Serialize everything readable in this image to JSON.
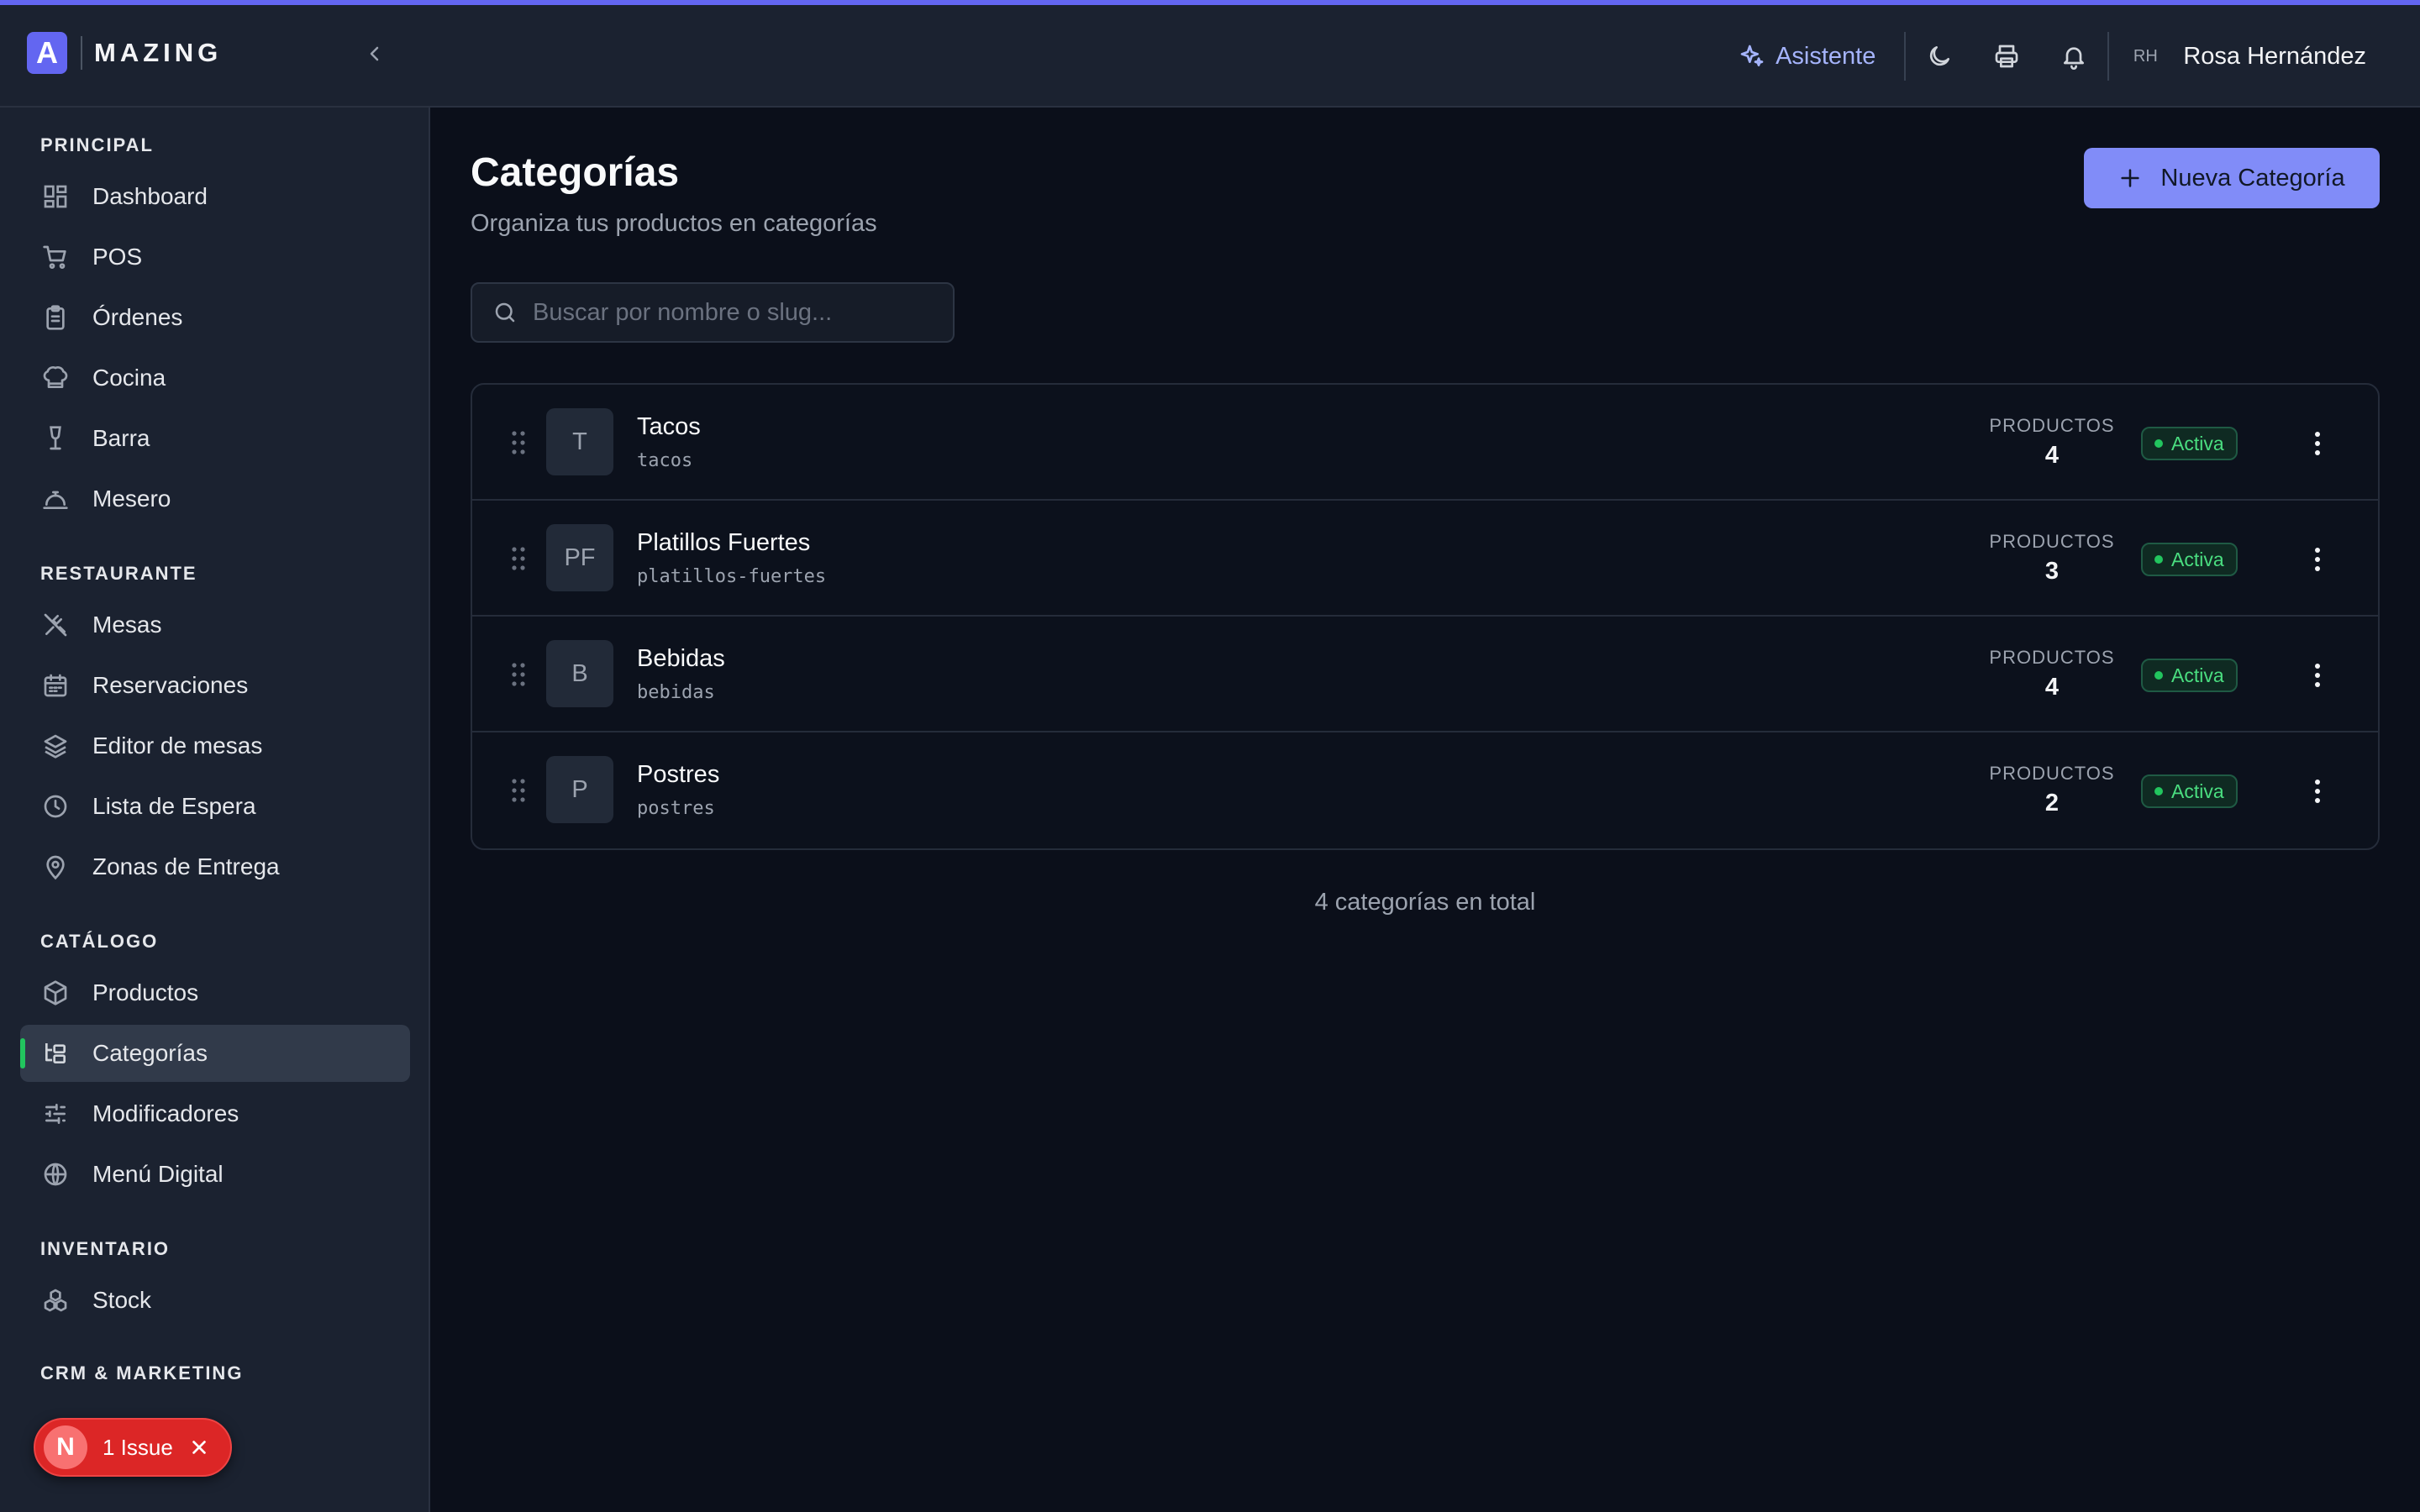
{
  "header": {
    "logo_letter": "A",
    "logo_text": "MAZING",
    "assistant_label": "Asistente",
    "user_initials": "RH",
    "user_name": "Rosa Hernández",
    "icons": [
      "sparkle-icon",
      "moon-icon",
      "printer-icon",
      "bell-icon",
      "chevron-left-icon"
    ]
  },
  "sidebar": {
    "sections": {
      "principal": "PRINCIPAL",
      "restaurante": "RESTAURANTE",
      "catalogo": "CATÁLOGO",
      "inventario": "INVENTARIO",
      "crm": "CRM & MARKETING"
    },
    "items": [
      {
        "label": "Dashboard",
        "icon": "dashboard-icon"
      },
      {
        "label": "POS",
        "icon": "cart-icon"
      },
      {
        "label": "Órdenes",
        "icon": "clipboard-icon"
      },
      {
        "label": "Cocina",
        "icon": "chef-hat-icon"
      },
      {
        "label": "Barra",
        "icon": "wine-glass-icon"
      },
      {
        "label": "Mesero",
        "icon": "service-bell-icon"
      },
      {
        "label": "Mesas",
        "icon": "utensils-icon"
      },
      {
        "label": "Reservaciones",
        "icon": "calendar-icon"
      },
      {
        "label": "Editor de mesas",
        "icon": "layers-icon"
      },
      {
        "label": "Lista de Espera",
        "icon": "clock-icon"
      },
      {
        "label": "Zonas de Entrega",
        "icon": "map-pin-icon"
      },
      {
        "label": "Productos",
        "icon": "package-icon"
      },
      {
        "label": "Categorías",
        "icon": "folder-tree-icon",
        "active": true
      },
      {
        "label": "Modificadores",
        "icon": "sliders-icon"
      },
      {
        "label": "Menú Digital",
        "icon": "globe-icon"
      },
      {
        "label": "Stock",
        "icon": "boxes-icon"
      }
    ]
  },
  "issue": {
    "letter": "N",
    "label": "1 Issue"
  },
  "main": {
    "title": "Categorías",
    "subtitle": "Organiza tus productos en categorías",
    "new_button": "Nueva Categoría",
    "search_placeholder": "Buscar por nombre o slug...",
    "products_label": "PRODUCTOS",
    "rows": [
      {
        "initials": "T",
        "name": "Tacos",
        "slug": "tacos",
        "count": "4",
        "status": "Activa"
      },
      {
        "initials": "PF",
        "name": "Platillos Fuertes",
        "slug": "platillos-fuertes",
        "count": "3",
        "status": "Activa"
      },
      {
        "initials": "B",
        "name": "Bebidas",
        "slug": "bebidas",
        "count": "4",
        "status": "Activa"
      },
      {
        "initials": "P",
        "name": "Postres",
        "slug": "postres",
        "count": "2",
        "status": "Activa"
      }
    ],
    "total": "4 categorías en total"
  },
  "colors": {
    "accent": "#6366f1",
    "button": "#818cf8",
    "active_indicator": "#22c55e",
    "status_green": "#4ade80",
    "issue_red": "#dc2626"
  }
}
